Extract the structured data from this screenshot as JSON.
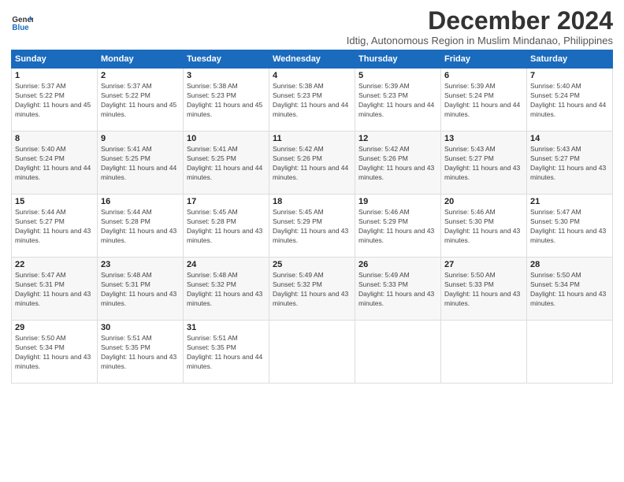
{
  "logo": {
    "line1": "General",
    "line2": "Blue"
  },
  "title": "December 2024",
  "subtitle": "Idtig, Autonomous Region in Muslim Mindanao, Philippines",
  "days_header": [
    "Sunday",
    "Monday",
    "Tuesday",
    "Wednesday",
    "Thursday",
    "Friday",
    "Saturday"
  ],
  "weeks": [
    [
      {
        "day": "1",
        "sunrise": "5:37 AM",
        "sunset": "5:22 PM",
        "daylight": "11 hours and 45 minutes."
      },
      {
        "day": "2",
        "sunrise": "5:37 AM",
        "sunset": "5:22 PM",
        "daylight": "11 hours and 45 minutes."
      },
      {
        "day": "3",
        "sunrise": "5:38 AM",
        "sunset": "5:23 PM",
        "daylight": "11 hours and 45 minutes."
      },
      {
        "day": "4",
        "sunrise": "5:38 AM",
        "sunset": "5:23 PM",
        "daylight": "11 hours and 44 minutes."
      },
      {
        "day": "5",
        "sunrise": "5:39 AM",
        "sunset": "5:23 PM",
        "daylight": "11 hours and 44 minutes."
      },
      {
        "day": "6",
        "sunrise": "5:39 AM",
        "sunset": "5:24 PM",
        "daylight": "11 hours and 44 minutes."
      },
      {
        "day": "7",
        "sunrise": "5:40 AM",
        "sunset": "5:24 PM",
        "daylight": "11 hours and 44 minutes."
      }
    ],
    [
      {
        "day": "8",
        "sunrise": "5:40 AM",
        "sunset": "5:24 PM",
        "daylight": "11 hours and 44 minutes."
      },
      {
        "day": "9",
        "sunrise": "5:41 AM",
        "sunset": "5:25 PM",
        "daylight": "11 hours and 44 minutes."
      },
      {
        "day": "10",
        "sunrise": "5:41 AM",
        "sunset": "5:25 PM",
        "daylight": "11 hours and 44 minutes."
      },
      {
        "day": "11",
        "sunrise": "5:42 AM",
        "sunset": "5:26 PM",
        "daylight": "11 hours and 44 minutes."
      },
      {
        "day": "12",
        "sunrise": "5:42 AM",
        "sunset": "5:26 PM",
        "daylight": "11 hours and 43 minutes."
      },
      {
        "day": "13",
        "sunrise": "5:43 AM",
        "sunset": "5:27 PM",
        "daylight": "11 hours and 43 minutes."
      },
      {
        "day": "14",
        "sunrise": "5:43 AM",
        "sunset": "5:27 PM",
        "daylight": "11 hours and 43 minutes."
      }
    ],
    [
      {
        "day": "15",
        "sunrise": "5:44 AM",
        "sunset": "5:27 PM",
        "daylight": "11 hours and 43 minutes."
      },
      {
        "day": "16",
        "sunrise": "5:44 AM",
        "sunset": "5:28 PM",
        "daylight": "11 hours and 43 minutes."
      },
      {
        "day": "17",
        "sunrise": "5:45 AM",
        "sunset": "5:28 PM",
        "daylight": "11 hours and 43 minutes."
      },
      {
        "day": "18",
        "sunrise": "5:45 AM",
        "sunset": "5:29 PM",
        "daylight": "11 hours and 43 minutes."
      },
      {
        "day": "19",
        "sunrise": "5:46 AM",
        "sunset": "5:29 PM",
        "daylight": "11 hours and 43 minutes."
      },
      {
        "day": "20",
        "sunrise": "5:46 AM",
        "sunset": "5:30 PM",
        "daylight": "11 hours and 43 minutes."
      },
      {
        "day": "21",
        "sunrise": "5:47 AM",
        "sunset": "5:30 PM",
        "daylight": "11 hours and 43 minutes."
      }
    ],
    [
      {
        "day": "22",
        "sunrise": "5:47 AM",
        "sunset": "5:31 PM",
        "daylight": "11 hours and 43 minutes."
      },
      {
        "day": "23",
        "sunrise": "5:48 AM",
        "sunset": "5:31 PM",
        "daylight": "11 hours and 43 minutes."
      },
      {
        "day": "24",
        "sunrise": "5:48 AM",
        "sunset": "5:32 PM",
        "daylight": "11 hours and 43 minutes."
      },
      {
        "day": "25",
        "sunrise": "5:49 AM",
        "sunset": "5:32 PM",
        "daylight": "11 hours and 43 minutes."
      },
      {
        "day": "26",
        "sunrise": "5:49 AM",
        "sunset": "5:33 PM",
        "daylight": "11 hours and 43 minutes."
      },
      {
        "day": "27",
        "sunrise": "5:50 AM",
        "sunset": "5:33 PM",
        "daylight": "11 hours and 43 minutes."
      },
      {
        "day": "28",
        "sunrise": "5:50 AM",
        "sunset": "5:34 PM",
        "daylight": "11 hours and 43 minutes."
      }
    ],
    [
      {
        "day": "29",
        "sunrise": "5:50 AM",
        "sunset": "5:34 PM",
        "daylight": "11 hours and 43 minutes."
      },
      {
        "day": "30",
        "sunrise": "5:51 AM",
        "sunset": "5:35 PM",
        "daylight": "11 hours and 43 minutes."
      },
      {
        "day": "31",
        "sunrise": "5:51 AM",
        "sunset": "5:35 PM",
        "daylight": "11 hours and 44 minutes."
      },
      null,
      null,
      null,
      null
    ]
  ]
}
